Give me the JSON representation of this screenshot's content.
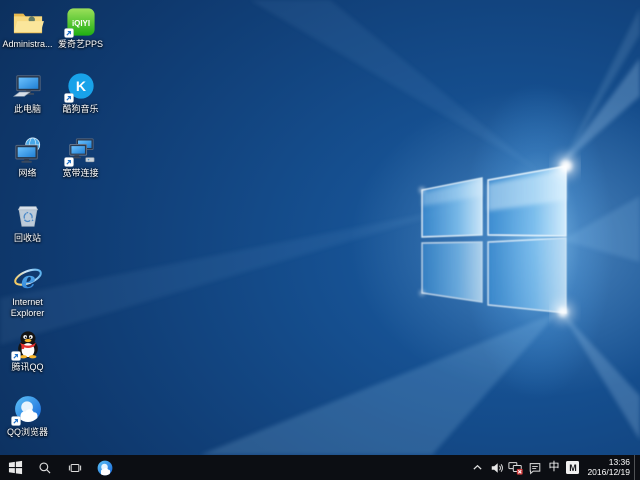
{
  "desktop": {
    "column1": [
      {
        "label": "Administra...",
        "icon": "user-folder-icon",
        "shortcut": false
      },
      {
        "label": "此电脑",
        "icon": "this-pc-icon",
        "shortcut": false
      },
      {
        "label": "网络",
        "icon": "network-icon",
        "shortcut": false
      },
      {
        "label": "回收站",
        "icon": "recycle-bin-icon",
        "shortcut": false
      },
      {
        "label": "Internet Explorer",
        "icon": "internet-explorer-icon",
        "shortcut": false
      },
      {
        "label": "腾讯QQ",
        "icon": "tencent-qq-icon",
        "shortcut": true
      },
      {
        "label": "QQ浏览器",
        "icon": "qq-browser-icon",
        "shortcut": true
      }
    ],
    "column2": [
      {
        "label": "爱奇艺PPS",
        "icon": "iqiyi-pps-icon",
        "shortcut": true
      },
      {
        "label": "酷狗音乐",
        "icon": "kugou-music-icon",
        "shortcut": true
      },
      {
        "label": "宽带连接",
        "icon": "broadband-connection-icon",
        "shortcut": true
      }
    ]
  },
  "taskbar": {
    "left_icons": [
      "windows-start-icon",
      "search-icon",
      "task-view-icon",
      "qq-browser-icon"
    ]
  },
  "tray": {
    "icons": [
      "chevron-up-icon",
      "volume-icon",
      "network-disconnected-icon",
      "action-center-icon"
    ],
    "ime_mode": "中",
    "ime_lang": "M",
    "time": "13:36",
    "date": "2016/12/19"
  },
  "colors": {
    "taskbar": "#0c0e13",
    "wallpaper_highlight": "#2e86d8",
    "wallpaper_dark": "#061830",
    "network_error_badge": "#d23b3b"
  }
}
